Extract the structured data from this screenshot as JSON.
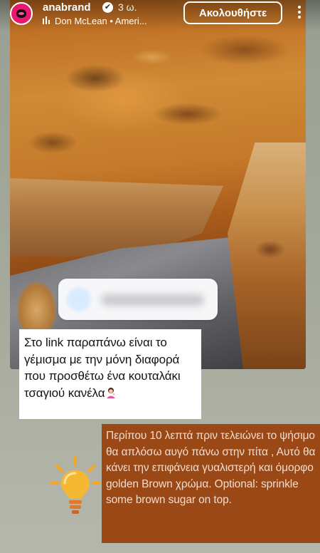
{
  "header": {
    "username": "anabrand",
    "verified": "✔",
    "time": "3 ω.",
    "music": "Don McLean • Ameri...",
    "follow_label": "Ακολουθήστε"
  },
  "story": {
    "note1": "Στο link παραπάνω είναι το γέμισμα με την μόνη διαφορά που προσθέτω ένα κουταλάκι τσαγιού κανέλα",
    "note2": "Περίπου 10 λεπτά πριν τελειώνει το ψήσιμο θα απλόσω  αυγό πάνω στην πίτα , Αυτό θα κάνει την επιφάνεια γυαλιστερή και όμορφο golden Brown χρώμα. Optional: sprinkle some brown sugar on top."
  },
  "icons": {
    "avatar": "lips-logo",
    "verified": "verified-badge-icon",
    "music": "music-bars-icon",
    "more": "more-vertical-icon",
    "bulb": "light-bulb-icon",
    "emoji": "woman-tipping-hand-emoji"
  },
  "colors": {
    "avatar_bg": "#e8186f",
    "note2_bg": "#9a4815",
    "note2_text": "#f2ddd0",
    "bulb": "#f5a623"
  }
}
